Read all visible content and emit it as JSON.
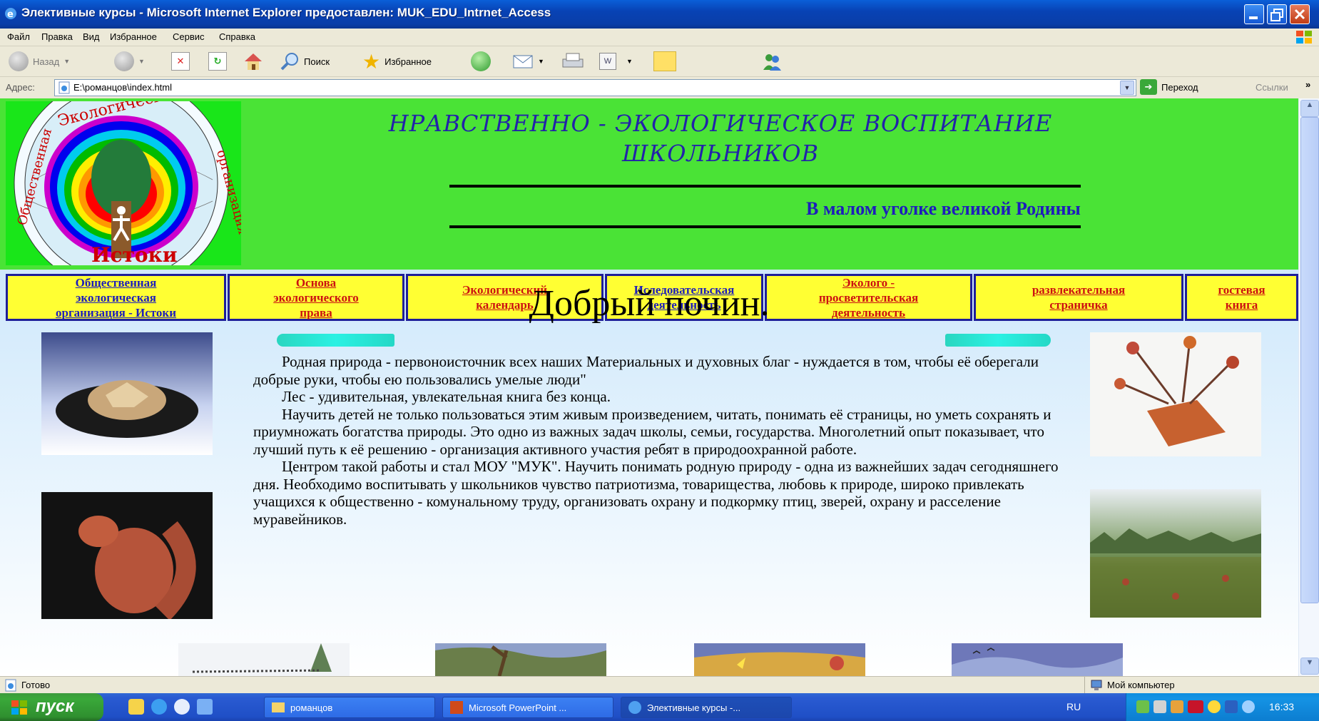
{
  "window": {
    "title": "Элективные курсы - Microsoft Internet Explorer предоставлен: MUK_EDU_Intrnet_Access"
  },
  "menu": [
    "Файл",
    "Правка",
    "Вид",
    "Избранное",
    "Сервис",
    "Справка"
  ],
  "toolbar": {
    "back": "Назад",
    "search": "Поиск",
    "favorites": "Избранное"
  },
  "address": {
    "label": "Адрес:",
    "url": "E:\\романцов\\index.html",
    "go": "Переход",
    "links": "Ссылки"
  },
  "page": {
    "logo_text_top": "Экологическая",
    "logo_text_left": "Общественная",
    "logo_text_right": "организация",
    "logo_text_bottom": "Истоки",
    "title_line1": "НРАВСТВЕННО - ЭКОЛОГИЧЕСКОЕ ВОСПИТАНИЕ",
    "title_line2": "ШКОЛЬНИКОВ",
    "slogan": "В малом уголке великой Родины",
    "nav": [
      {
        "line1": "Общественная",
        "line2": "экологическая",
        "line3": "организация - Истоки"
      },
      {
        "line1": "Основа",
        "line2": "экологического",
        "line3": "права"
      },
      {
        "line1": "Экологический",
        "line2": "календарь",
        "line3": ""
      },
      {
        "line1": "Иследовательская",
        "line2": "деятельность",
        "line3": ""
      },
      {
        "line1": "Эколого -",
        "line2": "просветительская",
        "line3": "деятельность"
      },
      {
        "line1": "развлекательная",
        "line2": "страничка",
        "line3": ""
      },
      {
        "line1": "гостевая",
        "line2": "книга",
        "line3": ""
      }
    ],
    "heading": "Добрый почин.",
    "paragraphs": [
      "Родная природа - первоноисточник всех наших Материальных и духовных благ - нуждается в том, чтобы её оберегали добрые руки, чтобы ею пользовались умелые люди\"",
      "Лес - удивительная, увлекательная книга без конца.",
      "Научить детей не только пользоваться этим живым произведением, читать, понимать её страницы, но уметь сохранять и приумножать богатства природы. Это одно из важных задач школы, семьи, государства. Многолетний опыт показывает, что лучший путь к её решению - организация активного участия ребят в природоохранной работе.",
      "Центром такой работы и стал МОУ \"МУК\". Научить понимать родную природу - одна из важнейших задач сегодняшнего дня. Необходимо воспитывать у школьников чувство патриотизма, товарищества, любовь к природе, широко привлекать учащихся к общественно - комунальному труду, организовать охрану и подкормку птиц, зверей, охрану и расселение муравейников."
    ]
  },
  "status": {
    "left": "Готово",
    "right": "Мой компьютер"
  },
  "taskbar": {
    "start": "пуск",
    "tasks": [
      "романцов",
      "Microsoft PowerPoint ...",
      "Элективные курсы -..."
    ],
    "lang": "RU",
    "time": "16:33"
  },
  "colors": {
    "header_green": "#4ae336",
    "nav_yellow": "#ffff33",
    "title_blue": "#2222aa",
    "nav_red": "#cc1111"
  }
}
